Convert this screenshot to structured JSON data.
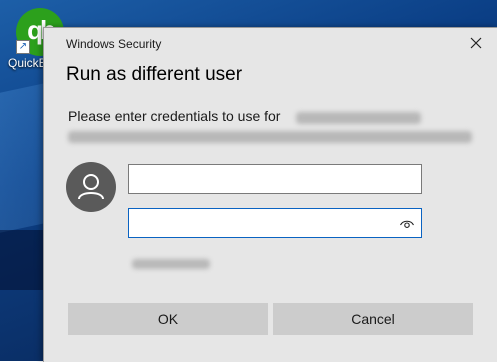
{
  "desktop": {
    "icon_name": "quickbooks-icon",
    "logo_text": "qb",
    "label": "QuickB",
    "brand_color": "#2ca01c"
  },
  "dialog": {
    "title": "Windows Security",
    "heading": "Run as different user",
    "prompt": "Please enter credentials to use for",
    "username": {
      "value": "",
      "placeholder": ""
    },
    "password": {
      "value": "",
      "placeholder": ""
    },
    "ok_label": "OK",
    "cancel_label": "Cancel",
    "accent_color": "#0a63c2"
  }
}
